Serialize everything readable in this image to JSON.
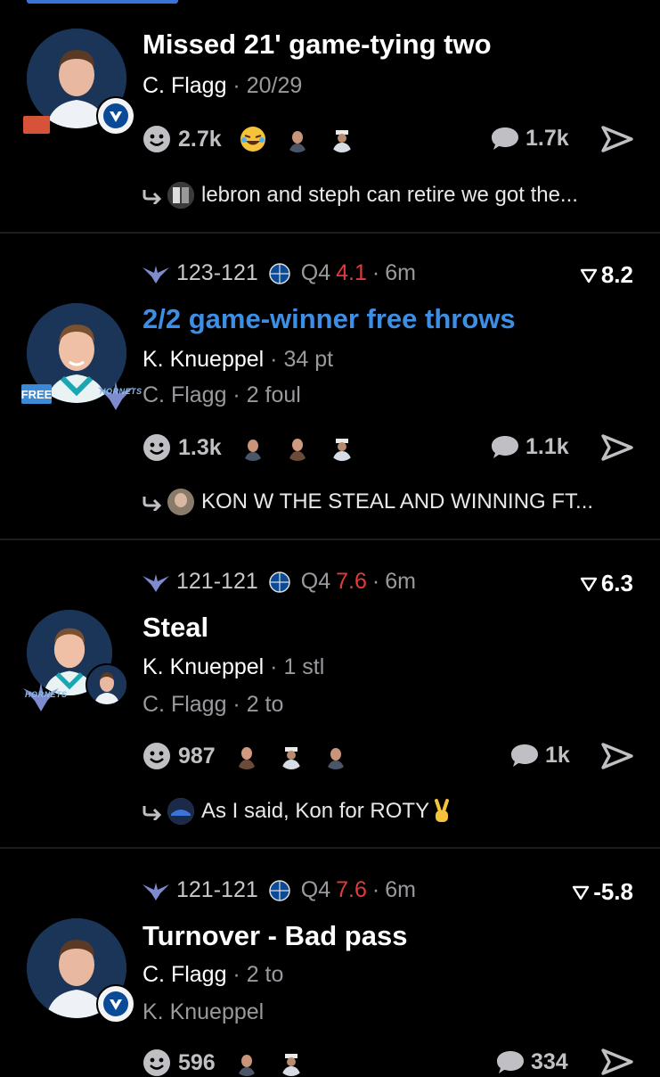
{
  "colors": {
    "accent": "#3d8fe6",
    "time_red": "#e33b3b",
    "background": "#000000",
    "muted": "#9a9a9e"
  },
  "icons": {
    "hornets_logo": "hornets-logo-icon",
    "mavs_ball": "basketball-icon",
    "rating": "chevron-down-icon",
    "reaction": "smile-icon",
    "comment": "comment-bubble-icon",
    "share": "share-arrow-icon",
    "reply": "reply-arrow-icon"
  },
  "plays": [
    {
      "title": "Missed 21' game-tying two",
      "player1": "C. Flagg",
      "stat1": "20/29",
      "reactions": "2.7k",
      "comments": "1.7k",
      "reply": "lebron and steph can retire we got the..."
    },
    {
      "score": "123-121",
      "quarter": "Q4",
      "time": "4.1",
      "ago": "6m",
      "rating": "8.2",
      "title": "2/2 game-winner free throws",
      "player1": "K. Knueppel",
      "stat1": "34 pt",
      "player2": "C. Flagg",
      "stat2": "2 foul",
      "badge": "FREE",
      "team_word": "HORNETS",
      "reactions": "1.3k",
      "comments": "1.1k",
      "reply": "KON W THE STEAL AND WINNING FT..."
    },
    {
      "score": "121-121",
      "quarter": "Q4",
      "time": "7.6",
      "ago": "6m",
      "rating": "6.3",
      "title": "Steal",
      "player1": "K. Knueppel",
      "stat1": "1 stl",
      "player2": "C. Flagg",
      "stat2": "2 to",
      "team_word": "HORNETS",
      "reactions": "987",
      "comments": "1k",
      "reply": "As I said, Kon for ROTY"
    },
    {
      "score": "121-121",
      "quarter": "Q4",
      "time": "7.6",
      "ago": "6m",
      "rating": "-5.8",
      "title": "Turnover - Bad pass",
      "player1": "C. Flagg",
      "stat1": "2 to",
      "player2": "K. Knueppel",
      "reactions": "596",
      "comments": "334"
    }
  ]
}
